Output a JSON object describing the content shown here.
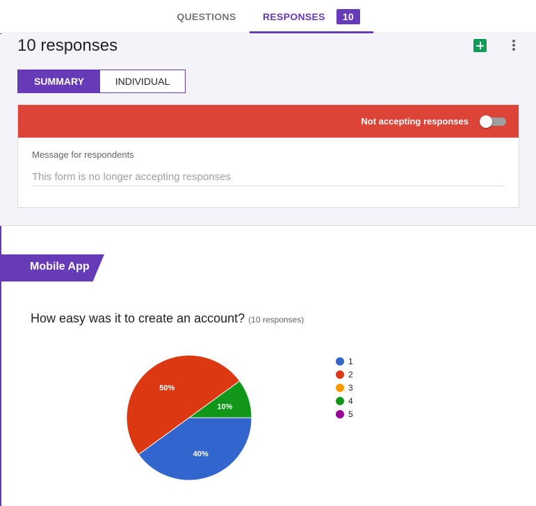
{
  "tabs": {
    "questions": "QUESTIONS",
    "responses": "RESPONSES",
    "responses_count": "10"
  },
  "summary": {
    "title": "10 responses",
    "view_toggle": [
      "SUMMARY",
      "INDIVIDUAL"
    ],
    "accepting_label": "Not accepting responses",
    "accepting_on": false,
    "message_label": "Message for respondents",
    "message_placeholder": "This form is no longer accepting responses"
  },
  "section": {
    "title": "Mobile App"
  },
  "question": {
    "title": "How easy was it to create an account?",
    "response_count": "(10 responses)"
  },
  "colors": {
    "accent": "#673ab7",
    "banner": "#db4437",
    "sheets": "#0f9d58"
  },
  "chart_data": {
    "type": "pie",
    "categories": [
      "1",
      "2",
      "3",
      "4",
      "5"
    ],
    "values": [
      40,
      50,
      0,
      10,
      0
    ],
    "colors": [
      "#3366cc",
      "#dc3912",
      "#ff9900",
      "#109618",
      "#990099"
    ],
    "labels": [
      "40%",
      "50%",
      "",
      "10%",
      ""
    ],
    "legend": "right"
  }
}
